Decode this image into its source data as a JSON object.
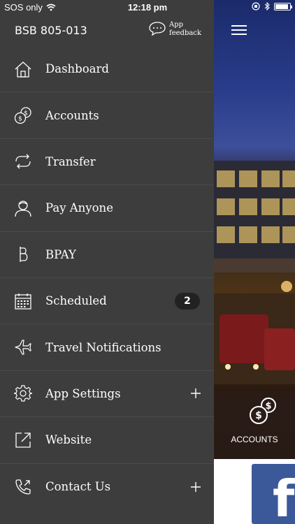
{
  "status_bar": {
    "carrier": "SOS only",
    "time": "12:18 pm",
    "battery_level": 0.9
  },
  "header": {
    "bsb": "BSB 805-013",
    "feedback_line1": "App",
    "feedback_line2": "feedback"
  },
  "menu": [
    {
      "label": "Dashboard",
      "icon": "home-icon"
    },
    {
      "label": "Accounts",
      "icon": "coins-icon"
    },
    {
      "label": "Transfer",
      "icon": "transfer-icon"
    },
    {
      "label": "Pay Anyone",
      "icon": "person-icon"
    },
    {
      "label": "BPAY",
      "icon": "bpay-icon"
    },
    {
      "label": "Scheduled",
      "icon": "calendar-icon",
      "badge": "2"
    },
    {
      "label": "Travel Notifications",
      "icon": "plane-icon"
    },
    {
      "label": "App Settings",
      "icon": "gear-icon",
      "expand": true
    },
    {
      "label": "Website",
      "icon": "external-link-icon"
    },
    {
      "label": "Contact Us",
      "icon": "phone-icon",
      "expand": true
    }
  ],
  "tile": {
    "accounts_label": "ACCOUNTS"
  },
  "colors": {
    "drawer_bg": "#3d3d3d",
    "facebook_blue": "#3b5998"
  }
}
